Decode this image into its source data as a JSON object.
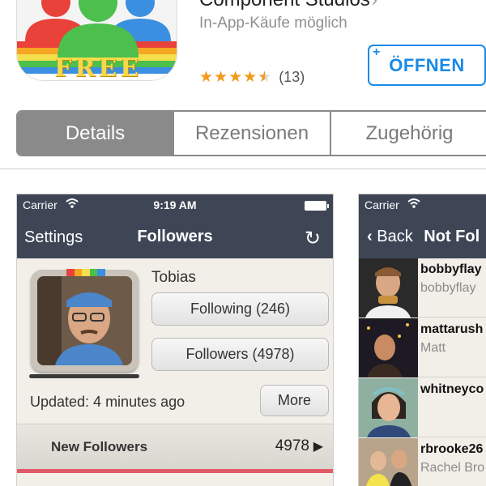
{
  "app": {
    "title": "Component Studios",
    "title_chevron": "›",
    "subtitle": "In-App-Käufe möglich",
    "rating_stars": "★★★★",
    "rating_half_star": "★",
    "rating_count": "(13)",
    "open_button_plus": "+",
    "open_button": "ÖFFNEN",
    "icon_banner_text": "FREE",
    "accent_color": "#1a8ae6",
    "star_color": "#f19a1b"
  },
  "tabs": [
    {
      "label": "Details",
      "active": true
    },
    {
      "label": "Rezensionen",
      "active": false
    },
    {
      "label": "Zugehörig",
      "active": false
    }
  ],
  "screenshot1": {
    "status": {
      "carrier": "Carrier",
      "time": "9:19 AM"
    },
    "nav": {
      "back": "Settings",
      "title": "Followers",
      "refresh_icon": "↻"
    },
    "profile": {
      "name": "Tobias"
    },
    "following_button": "Following (246)",
    "followers_button": "Followers (4978)",
    "updated": "Updated: 4 minutes ago",
    "more_button": "More",
    "new_followers": {
      "label": "New Followers",
      "value": "4978"
    },
    "accent_stripe_color": "#e15a66"
  },
  "screenshot2": {
    "status": {
      "carrier": "Carrier"
    },
    "nav": {
      "back": "Back",
      "title": "Not Fol"
    },
    "rows": [
      {
        "handle": "bobbyflay",
        "name": "bobbyflay"
      },
      {
        "handle": "mattarush",
        "name": "Matt"
      },
      {
        "handle": "whitneyco",
        "name": ""
      },
      {
        "handle": "rbrooke26",
        "name": "Rachel Bro"
      }
    ]
  }
}
